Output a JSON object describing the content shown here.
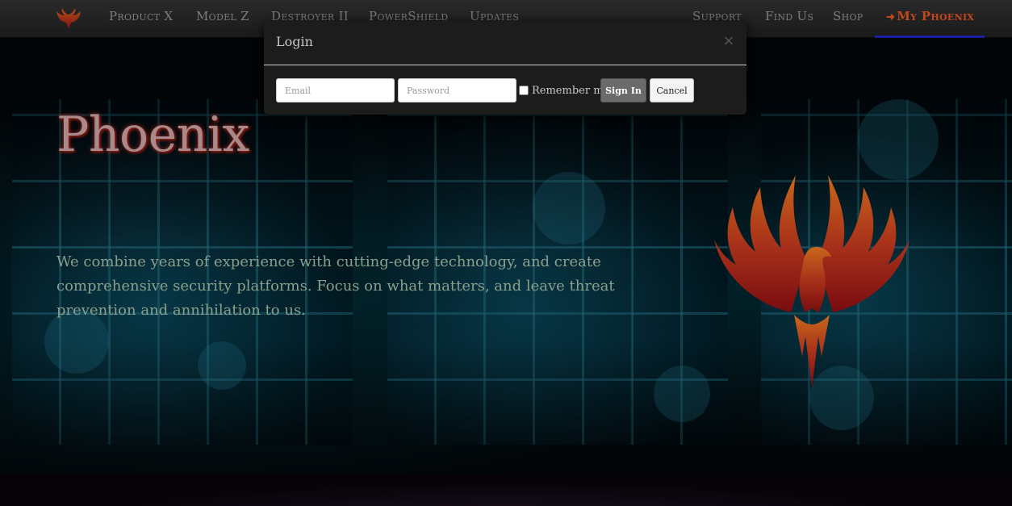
{
  "navbar": {
    "brand_icon": "phoenix-logo-icon",
    "left_items": [
      "Product X",
      "Model Z",
      "Destroyer II",
      "PowerShield",
      "Updates"
    ],
    "right_items": [
      "Support",
      "Find Us",
      "Shop"
    ],
    "account_item": "My Phoenix",
    "account_icon": "login-icon",
    "accent_color": "#c2471d"
  },
  "hero": {
    "title": "Phoenix",
    "text": "We combine years of experience with cutting-edge technology, and create comprehensive security platforms. Focus on what matters, and leave threat prevention and annihilation to us.",
    "logo_icon": "phoenix-emblem-icon"
  },
  "login_modal": {
    "title": "Login",
    "close_symbol": "×",
    "email_placeholder": "Email",
    "password_placeholder": "Password",
    "remember_label": "Remember me",
    "signin_label": "Sign In",
    "cancel_label": "Cancel"
  }
}
